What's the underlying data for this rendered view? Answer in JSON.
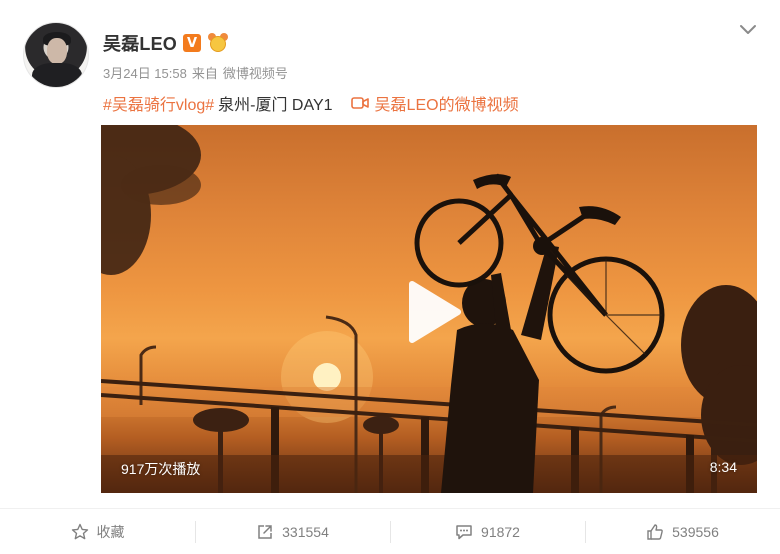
{
  "post": {
    "author": "吴磊LEO",
    "verified_badge": "V",
    "date": "3月24日 15:58",
    "source_prefix": "来自",
    "source": "微博视频号",
    "topic": "#吴磊骑行vlog#",
    "text": "泉州-厦门 DAY1",
    "video_link": "吴磊LEO的微博视频"
  },
  "video": {
    "plays": "917万次播放",
    "duration": "8:34"
  },
  "actions": {
    "favorite_label": "收藏",
    "repost_count": "331554",
    "comment_count": "91872",
    "like_count": "539556"
  },
  "colors": {
    "accent": "#eb7340",
    "badge": "#f37b1d"
  },
  "icons": [
    "chevron-down-icon",
    "video-icon",
    "star-icon",
    "share-icon",
    "comment-icon",
    "thumbs-up-icon",
    "play-icon"
  ]
}
